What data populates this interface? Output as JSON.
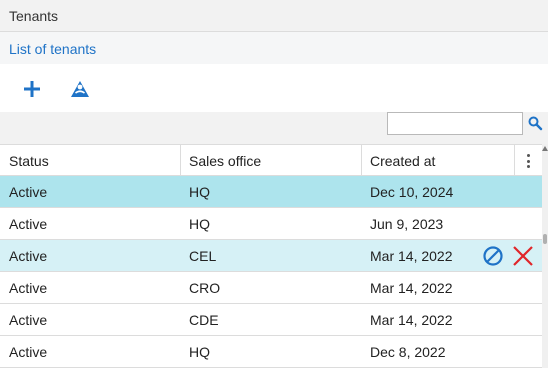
{
  "header": {
    "title": "Tenants"
  },
  "subheader": {
    "link": "List of tenants"
  },
  "toolbar": {
    "add_icon": "plus-icon",
    "import_icon": "import-icon"
  },
  "search": {
    "value": "",
    "placeholder": ""
  },
  "table": {
    "columns": [
      "Status",
      "Sales office",
      "Created at"
    ],
    "rows": [
      {
        "status": "Active",
        "office": "HQ",
        "created": "Dec 10, 2024"
      },
      {
        "status": "Active",
        "office": "HQ",
        "created": "Jun 9, 2023"
      },
      {
        "status": "Active",
        "office": "CEL",
        "created": "Mar 14, 2022"
      },
      {
        "status": "Active",
        "office": "CRO",
        "created": "Mar 14, 2022"
      },
      {
        "status": "Active",
        "office": "CDE",
        "created": "Mar 14, 2022"
      },
      {
        "status": "Active",
        "office": "HQ",
        "created": "Dec 8, 2022"
      }
    ]
  },
  "colors": {
    "accent": "#1f73c7",
    "selected_row": "#ade4ed",
    "hover_row": "#d6f1f6",
    "delete": "#e0262a"
  }
}
